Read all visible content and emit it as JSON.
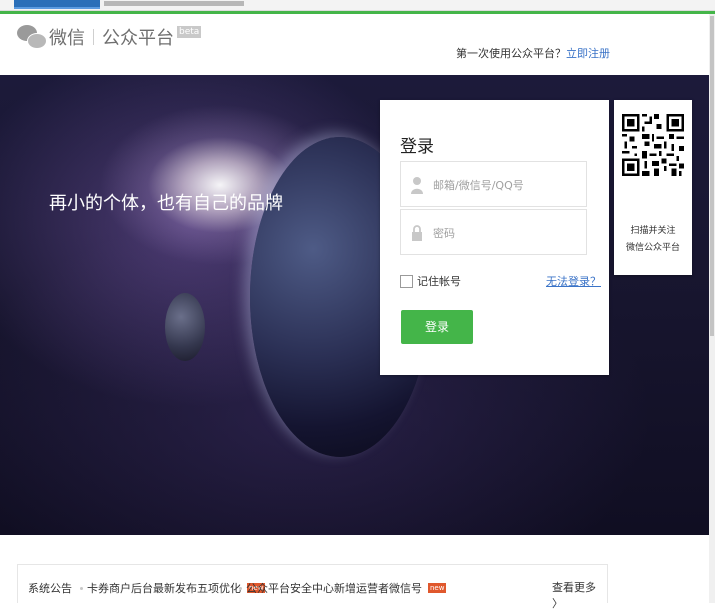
{
  "header": {
    "logo_wechat": "微信",
    "logo_platform": "公众平台",
    "logo_badge": "beta",
    "first_use_text": "第一次使用公众平台？",
    "register_link": "立即注册"
  },
  "hero": {
    "slogan": "再小的个体，也有自己的品牌"
  },
  "login": {
    "title": "登录",
    "account_placeholder": "邮箱/微信号/QQ号",
    "password_placeholder": "密码",
    "remember_label": "记住帐号",
    "cant_login_link": "无法登录？",
    "submit_label": "登录"
  },
  "qr": {
    "caption_line1": "扫描并关注",
    "caption_line2": "微信公众平台"
  },
  "notice": {
    "label": "系统公告",
    "items": [
      {
        "text": "卡券商户后台最新发布五项优化",
        "badge": "new"
      },
      {
        "text": "公众平台安全中心新增运营者微信号",
        "badge": "new"
      }
    ],
    "more": "查看更多"
  },
  "colors": {
    "accent_green": "#44b549",
    "link_blue": "#3a73c7"
  }
}
